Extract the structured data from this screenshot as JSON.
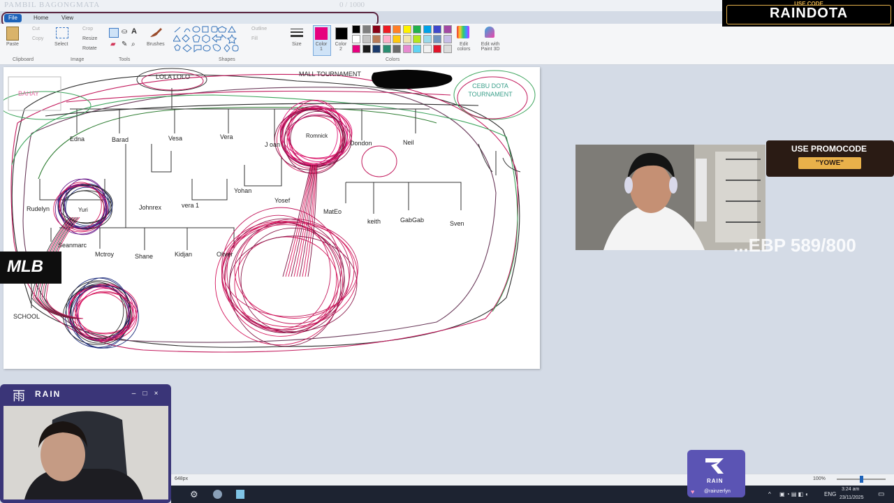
{
  "window": {
    "title": "PAMBIL BAGONGMATA",
    "progress": "0 / 1000"
  },
  "menu": {
    "file": "File",
    "home": "Home",
    "view": "View"
  },
  "ribbon": {
    "paste": "Paste",
    "cut": "Cut",
    "copy": "Copy",
    "select": "Select",
    "crop": "Crop",
    "resize": "Resize",
    "rotate": "Rotate",
    "brushes": "Brushes",
    "outline": "Outline",
    "fill": "Fill",
    "size": "Size",
    "color1": "Color 1",
    "color2": "Color 2",
    "edit_colors": "Edit colors",
    "edit_paint3d": "Edit with Paint 3D",
    "groups": {
      "clipboard": "Clipboard",
      "image": "Image",
      "tools": "Tools",
      "shapes": "Shapes",
      "colors": "Colors"
    },
    "palette_row1": [
      "#000000",
      "#7f7f7f",
      "#880015",
      "#ed1c24",
      "#ff7f27",
      "#fff200",
      "#22b14c",
      "#00a2e8",
      "#3f48cc",
      "#a349a4"
    ],
    "palette_row2": [
      "#ffffff",
      "#c3c3c3",
      "#b97a57",
      "#ffaec9",
      "#ffc90e",
      "#efe4b0",
      "#b5e61d",
      "#99d9ea",
      "#7092be",
      "#c8bfe7"
    ],
    "palette_row3": [
      "#e6007e",
      "#1a1a1a",
      "#1b3a6b",
      "#2a8c70",
      "#6a6a6a",
      "#e68ad0",
      "#5fd3f3",
      "#f1f1f1",
      "#e0142a",
      "#dcdcdc"
    ],
    "color1_value": "#e6007e",
    "color2_value": "#000000"
  },
  "canvas": {
    "labels": {
      "bahay": "BAHAY",
      "lola_lolo": "LOLA LOLO",
      "mall_tournament": "MALL TOURNAMENT",
      "cebu_dota": "CEBU DOTA TOURNAMENT",
      "edna": "Edna",
      "barad": "Barad",
      "vesa": "Vesa",
      "vera": "Vera",
      "joan": "J oan",
      "romnick": "Romnick",
      "dondon": "Dondon",
      "neil": "Neil",
      "yohan": "Yohan",
      "yosef": "Yosef",
      "rudelyn": "Rudelyn",
      "yuri": "Yuri",
      "johnrex": "Johnrex",
      "vera1": "vera 1",
      "mateo": "MatEo",
      "keith": "keith",
      "gabgab": "GabGab",
      "sven": "Sven",
      "seanmarc": "Seanmarc",
      "mctroy": "Mctroy",
      "shane": "Shane",
      "kidjan": "Kidjan",
      "oliver": "Oliver",
      "school": "SCHOOL"
    }
  },
  "overlay": {
    "brand_small": "USE CODE",
    "brand_big": "RAINDOTA",
    "promo_title": "USE PROMOCODE",
    "promo_code": "\"YOWE\"",
    "mmr": "...EBP 589/800",
    "mlb": "MLB",
    "rain_window_title": "RAIN",
    "rain_handle": "@rainzerfyn"
  },
  "statusbar": {
    "size": "648px",
    "zoom": "100%"
  },
  "tray": {
    "lang": "ENG",
    "time": "3:24 am",
    "date": "23/11/2025"
  }
}
